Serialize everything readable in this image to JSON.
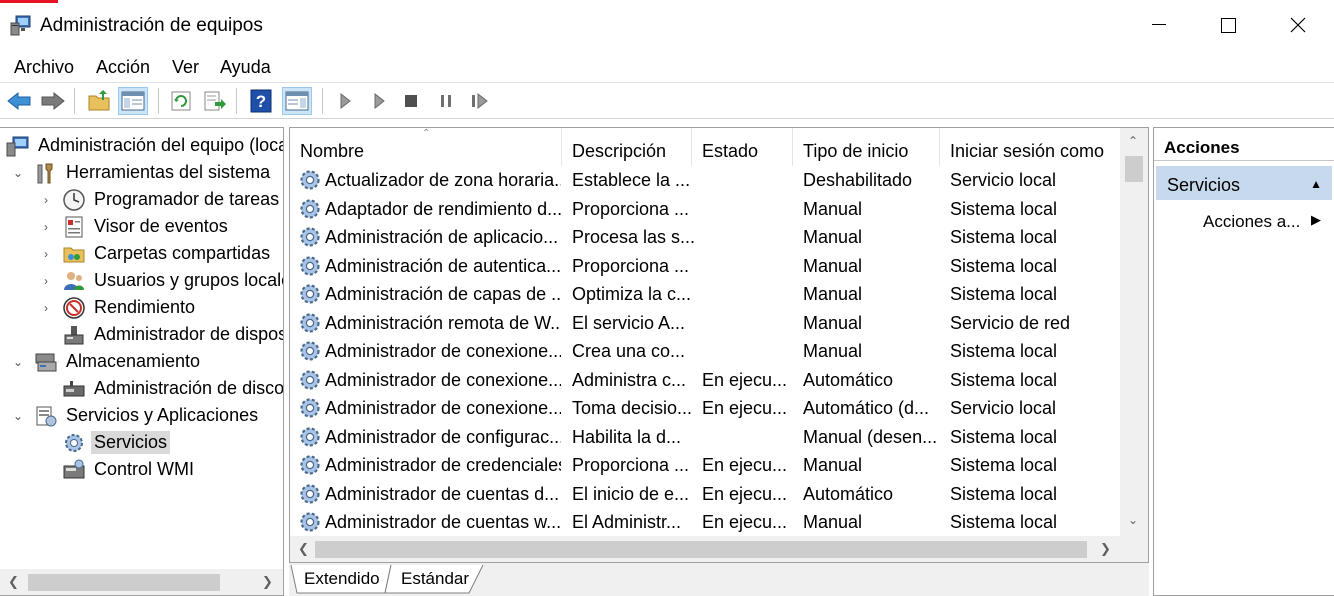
{
  "window": {
    "title": "Administración de equipos",
    "controls": [
      "minimize",
      "maximize",
      "close"
    ]
  },
  "menu": [
    "Archivo",
    "Acción",
    "Ver",
    "Ayuda"
  ],
  "toolbar": {
    "buttons": [
      "back-icon",
      "forward-icon",
      "up-folder-icon",
      "show-hide-tree-icon",
      "refresh-icon",
      "export-list-icon",
      "help-icon",
      "action-pane-icon",
      "start-service-icon",
      "start-service-alt-icon",
      "stop-service-icon",
      "pause-service-icon",
      "restart-service-icon"
    ]
  },
  "tree": {
    "items": [
      {
        "label": "Administración del equipo (loca",
        "icon": "computer-management-icon"
      },
      {
        "label": "Herramientas del sistema",
        "icon": "system-tools-icon"
      },
      {
        "label": "Programador de tareas",
        "icon": "task-scheduler-icon"
      },
      {
        "label": "Visor de eventos",
        "icon": "event-viewer-icon"
      },
      {
        "label": "Carpetas compartidas",
        "icon": "shared-folders-icon"
      },
      {
        "label": "Usuarios y grupos locale",
        "icon": "local-users-icon"
      },
      {
        "label": "Rendimiento",
        "icon": "performance-icon"
      },
      {
        "label": "Administrador de dispos",
        "icon": "device-manager-icon"
      },
      {
        "label": "Almacenamiento",
        "icon": "storage-icon"
      },
      {
        "label": "Administración de disco",
        "icon": "disk-management-icon"
      },
      {
        "label": "Servicios y Aplicaciones",
        "icon": "services-applications-icon"
      },
      {
        "label": "Servicios",
        "icon": "services-icon"
      },
      {
        "label": "Control WMI",
        "icon": "wmi-control-icon"
      }
    ]
  },
  "list": {
    "columns": [
      "Nombre",
      "Descripción",
      "Estado",
      "Tipo de inicio",
      "Iniciar sesión como"
    ],
    "rows": [
      [
        "Actualizador de zona horaria...",
        "Establece la ...",
        "",
        "Deshabilitado",
        "Servicio local"
      ],
      [
        "Adaptador de rendimiento d...",
        "Proporciona ...",
        "",
        "Manual",
        "Sistema local"
      ],
      [
        "Administración de aplicacio...",
        "Procesa las s...",
        "",
        "Manual",
        "Sistema local"
      ],
      [
        "Administración de autentica...",
        "Proporciona ...",
        "",
        "Manual",
        "Sistema local"
      ],
      [
        "Administración de capas de ...",
        "Optimiza la c...",
        "",
        "Manual",
        "Sistema local"
      ],
      [
        "Administración remota de W...",
        "El servicio A...",
        "",
        "Manual",
        "Servicio de red"
      ],
      [
        "Administrador de conexione...",
        "Crea una co...",
        "",
        "Manual",
        "Sistema local"
      ],
      [
        "Administrador de conexione...",
        "Administra c...",
        "En ejecu...",
        "Automático",
        "Sistema local"
      ],
      [
        "Administrador de conexione...",
        "Toma decisio...",
        "En ejecu...",
        "Automático (d...",
        "Servicio local"
      ],
      [
        "Administrador de configurac...",
        "Habilita la d...",
        "",
        "Manual (desen...",
        "Sistema local"
      ],
      [
        "Administrador de credenciales",
        "Proporciona ...",
        "En ejecu...",
        "Manual",
        "Sistema local"
      ],
      [
        "Administrador de cuentas d...",
        "El inicio de e...",
        "En ejecu...",
        "Automático",
        "Sistema local"
      ],
      [
        "Administrador de cuentas w...",
        "El Administr...",
        "En ejecu...",
        "Manual",
        "Sistema local"
      ]
    ]
  },
  "tabs": [
    "Extendido",
    "Estándar"
  ],
  "actions": {
    "header": "Acciones",
    "group": "Servicios",
    "item": "Acciones a..."
  }
}
